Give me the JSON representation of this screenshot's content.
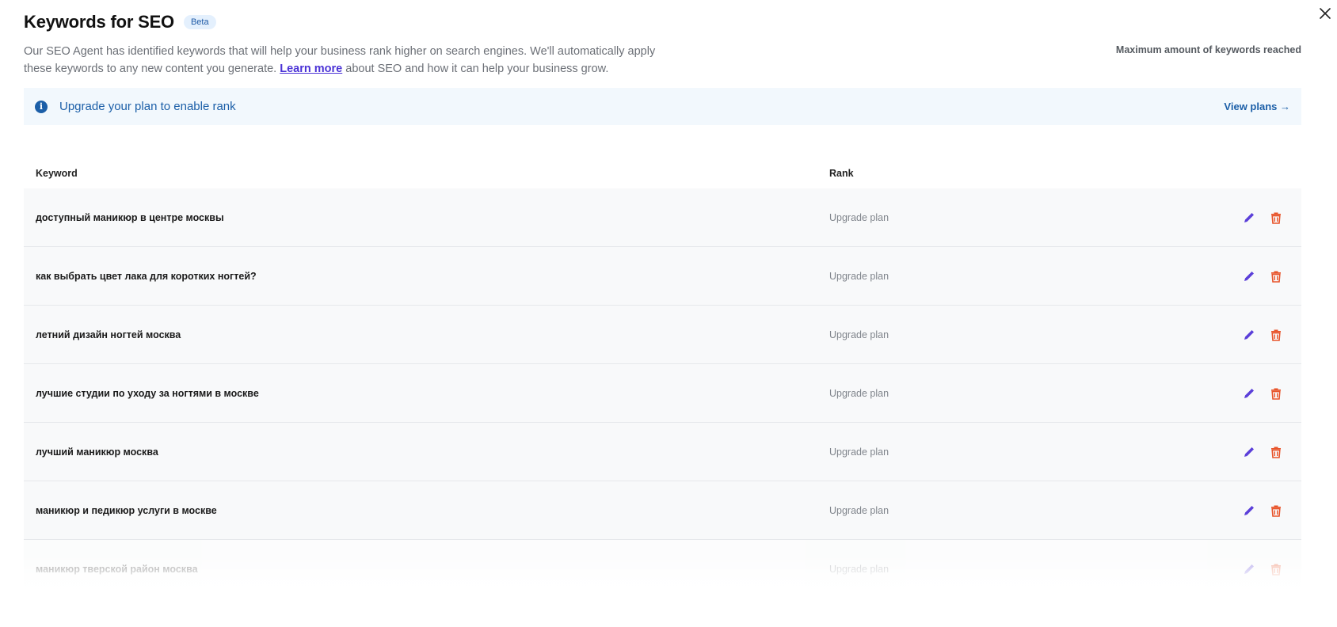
{
  "header": {
    "title": "Keywords for SEO",
    "badge": "Beta",
    "description_part1": "Our SEO Agent has identified keywords that will help your business rank higher on search engines. We'll automatically apply these keywords to any new content you generate.",
    "learn_more": "Learn more",
    "description_part2": "about SEO and how it can help your business grow.",
    "max_note": "Maximum amount of keywords reached"
  },
  "banner": {
    "icon": "info-icon",
    "text": "Upgrade your plan to enable rank",
    "link": "View plans →"
  },
  "table": {
    "columns": {
      "keyword": "Keyword",
      "rank": "Rank"
    },
    "rows": [
      {
        "keyword": "доступный маникюр в центре москвы",
        "rank": "Upgrade plan"
      },
      {
        "keyword": "как выбрать цвет лака для коротких ногтей?",
        "rank": "Upgrade plan"
      },
      {
        "keyword": "летний дизайн ногтей москва",
        "rank": "Upgrade plan"
      },
      {
        "keyword": "лучшие студии по уходу за ногтями в москве",
        "rank": "Upgrade plan"
      },
      {
        "keyword": "лучший маникюр москва",
        "rank": "Upgrade plan"
      },
      {
        "keyword": "маникюр и педикюр услуги в москве",
        "rank": "Upgrade plan"
      },
      {
        "keyword": "маникюр тверской район москва",
        "rank": "Upgrade plan"
      }
    ]
  },
  "icons": {
    "edit": "pencil-icon",
    "delete": "trash-icon",
    "close": "close-icon"
  },
  "colors": {
    "edit_icon": "#5b3fd9",
    "delete_icon": "#e8542a",
    "banner_text": "#1c5fa8",
    "link": "#4a32d6"
  }
}
